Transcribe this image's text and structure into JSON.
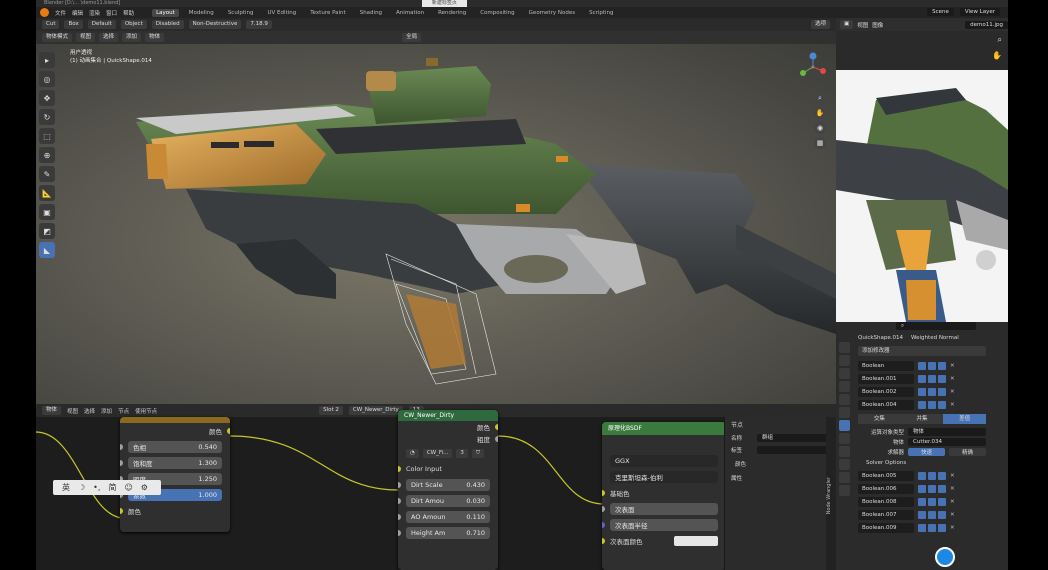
{
  "titlebar": {
    "text": "Blender [D:\\... \\demo11.blend]",
    "tab": "新建标签页"
  },
  "menu": {
    "items": [
      "文件",
      "编辑",
      "渲染",
      "窗口",
      "帮助"
    ]
  },
  "workspaces": [
    "Layout",
    "Modeling",
    "Sculpting",
    "UV Editing",
    "Texture Paint",
    "Shading",
    "Animation",
    "Rendering",
    "Compositing",
    "Geometry Nodes",
    "Scripting"
  ],
  "active_workspace": "Layout",
  "scene": {
    "label": "Scene",
    "view_layer": "View Layer"
  },
  "header2": {
    "cut": "Cut",
    "box": "Box",
    "default": "Default",
    "object": "Object",
    "disabled": "Disabled",
    "non_destructive": "Non-Destructive",
    "value": "7.18.9",
    "options": "选项"
  },
  "header3": {
    "mode": "物体模式",
    "view": "视图",
    "select": "选择",
    "add": "添加",
    "object": "物体",
    "global": "全局"
  },
  "viewport": {
    "line1": "用户透视",
    "line2": "(1) 动画集合 | QuickShape.014"
  },
  "reference": {
    "view": "视图",
    "image": "图像",
    "filename": "demo11.jpg"
  },
  "properties": {
    "object": "QuickShape.014",
    "modifier_label": "Weighted Normal",
    "add_modifier": "添加修改器",
    "modifiers": [
      "Boolean",
      "Boolean.001",
      "Boolean.002",
      "Boolean.004"
    ],
    "boolean_tabs": [
      "交集",
      "并集",
      "差值"
    ],
    "operand_type_label": "运算对象类型",
    "operand_type": "物体",
    "object_label": "物体",
    "object_value": "Cutter.034",
    "solver_label": "求解器",
    "solver_fast": "快速",
    "solver_exact": "精确",
    "solver_options": "Solver Options",
    "modifiers2": [
      "Boolean.005",
      "Boolean.006",
      "Boolean.008",
      "Boolean.007",
      "Boolean.009"
    ]
  },
  "node_header": {
    "mode": "物体",
    "view": "视图",
    "select": "选择",
    "add": "添加",
    "node": "节点",
    "use_nodes": "使用节点",
    "slot": "Slot 2",
    "material": "CW_Newer_Dirty",
    "users": "13"
  },
  "hsv_node": {
    "out_label": "颜色",
    "fields": [
      {
        "label": "色相",
        "value": "0.540"
      },
      {
        "label": "饱和度",
        "value": "1.300"
      },
      {
        "label": "明度",
        "value": "1.250"
      },
      {
        "label": "系数",
        "value": "1.000"
      }
    ],
    "in_label": "颜色"
  },
  "group_node": {
    "title": "CW_Newer_Dirty",
    "outputs": [
      "颜色",
      "粗度"
    ],
    "sub_name": "CW_Fi...",
    "sub_users": "3",
    "input_label": "Color Input",
    "fields": [
      {
        "label": "Dirt Scale",
        "value": "0.430"
      },
      {
        "label": "Dirt Amou",
        "value": "0.030"
      },
      {
        "label": "AO Amoun",
        "value": "0.110"
      },
      {
        "label": "Height Am",
        "value": "0.710"
      }
    ]
  },
  "bsdf_node": {
    "title": "原理化BSDF",
    "distribution": "GGX",
    "subsurface_method": "克里斯坦森-伯利",
    "inputs": [
      "基础色",
      "次表面",
      "次表面半径",
      "次表面颜色"
    ]
  },
  "node_panel": {
    "section": "节点",
    "name_label": "名称",
    "name_value": "群组",
    "label_label": "标签",
    "color": "颜色",
    "properties": "属性"
  },
  "node_vtab": "Node Wrangler",
  "ime": {
    "items": [
      "英",
      "☽",
      "•,",
      "简",
      "☺",
      "⚙"
    ]
  },
  "colors": {
    "accent": "#4772b3",
    "orange": "#e87d0d",
    "bsdf_header": "#3b7a3d",
    "group_header": "#2e6a3e",
    "hsv_header": "#8a6a1f"
  }
}
